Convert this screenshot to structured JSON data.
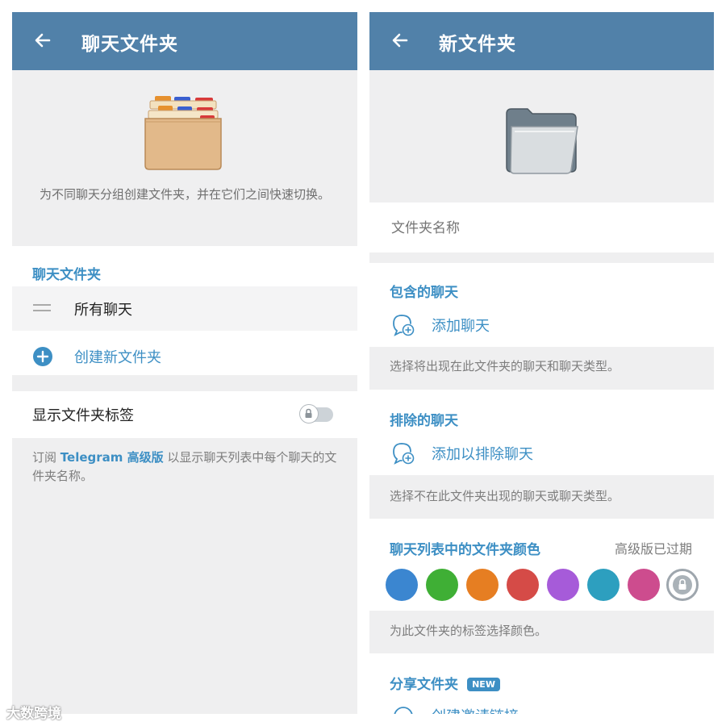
{
  "left": {
    "title": "聊天文件夹",
    "description": "为不同聊天分组创建文件夹，并在它们之间快速切换。",
    "section_header": "聊天文件夹",
    "folder_all": "所有聊天",
    "create_folder": "创建新文件夹",
    "show_tags_label": "显示文件夹标签",
    "show_tags_enabled": false,
    "subscribe_text": {
      "prefix": "订阅",
      "link": "Telegram 高级版",
      "suffix": "以显示聊天列表中每个聊天的文件夹名称。"
    }
  },
  "right": {
    "title": "新文件夹",
    "name_placeholder": "文件夹名称",
    "included_header": "包含的聊天",
    "add_chat": "添加聊天",
    "included_hint": "选择将出现在此文件夹的聊天和聊天类型。",
    "excluded_header": "排除的聊天",
    "add_excluded": "添加以排除聊天",
    "excluded_hint": "选择不在此文件夹出现的聊天或聊天类型。",
    "color_header": "聊天列表中的文件夹颜色",
    "premium_expired": "高级版已过期",
    "colors": [
      "#3b86d0",
      "#3faf35",
      "#e67e22",
      "#d54b47",
      "#a65bd9",
      "#2d9fbf",
      "#cd4c8e"
    ],
    "color_hint": "为此文件夹的标签选择颜色。",
    "share_header": "分享文件夹",
    "new_badge": "NEW",
    "create_invite": "创建邀请链接"
  },
  "watermark": "大数跨境",
  "icons": {
    "back": "arrow-left-icon",
    "folders": "folder-cabinet-icon",
    "folder": "folder-icon",
    "drag": "drag-handle-icon",
    "add": "plus-circle-icon",
    "add_chat": "chat-add-icon",
    "lock": "lock-icon"
  }
}
